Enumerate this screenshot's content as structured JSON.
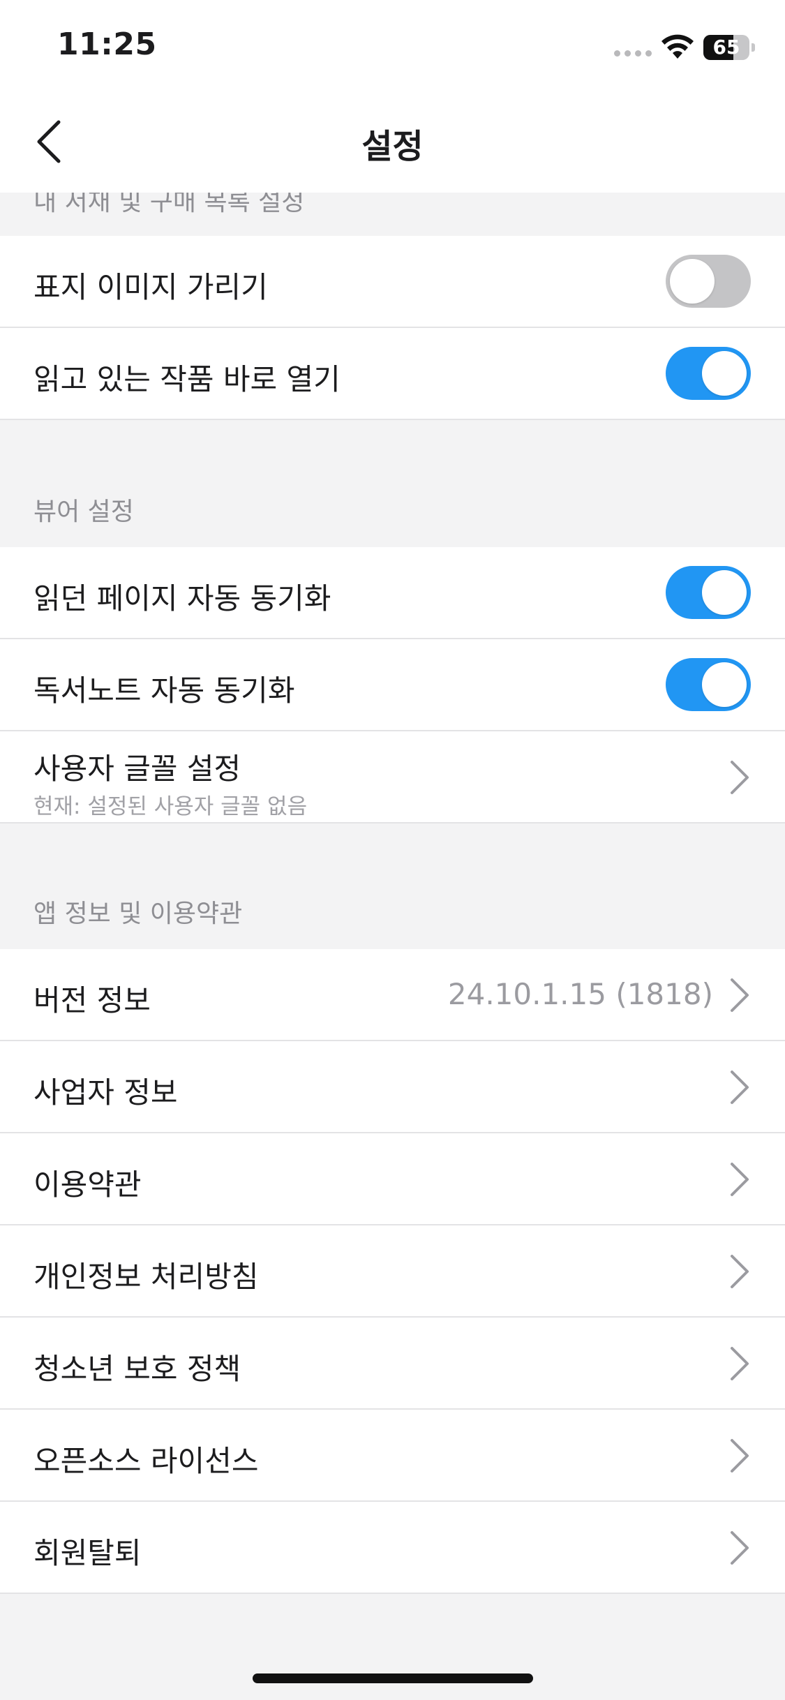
{
  "status_bar": {
    "time": "11:25",
    "battery_level": "65",
    "battery_fraction": 0.65
  },
  "nav": {
    "title": "설정",
    "back_icon": "chevron-left-icon"
  },
  "sections": {
    "library": {
      "header": "내 서재 및 구매 목록 설정",
      "rows": [
        {
          "label": "표지 이미지 가리기",
          "toggle": false
        },
        {
          "label": "읽고 있는 작품 바로 열기",
          "toggle": true
        }
      ]
    },
    "viewer": {
      "header": "뷰어 설정",
      "rows": [
        {
          "label": "읽던 페이지 자동 동기화",
          "toggle": true
        },
        {
          "label": "독서노트 자동 동기화",
          "toggle": true
        },
        {
          "label": "사용자 글꼴 설정",
          "sublabel": "현재: 설정된 사용자 글꼴 없음"
        }
      ]
    },
    "app_info": {
      "header": "앱 정보 및 이용약관",
      "rows": [
        {
          "label": "버전 정보",
          "value": "24.10.1.15 (1818)"
        },
        {
          "label": "사업자 정보"
        },
        {
          "label": "이용약관"
        },
        {
          "label": "개인정보 처리방침"
        },
        {
          "label": "청소년 보호 정책"
        },
        {
          "label": "오픈소스 라이선스"
        },
        {
          "label": "회원탈퇴"
        }
      ]
    }
  },
  "colors": {
    "toggle_on": "#2196f3",
    "toggle_off": "#c4c4c6",
    "background": "#f3f3f4"
  }
}
